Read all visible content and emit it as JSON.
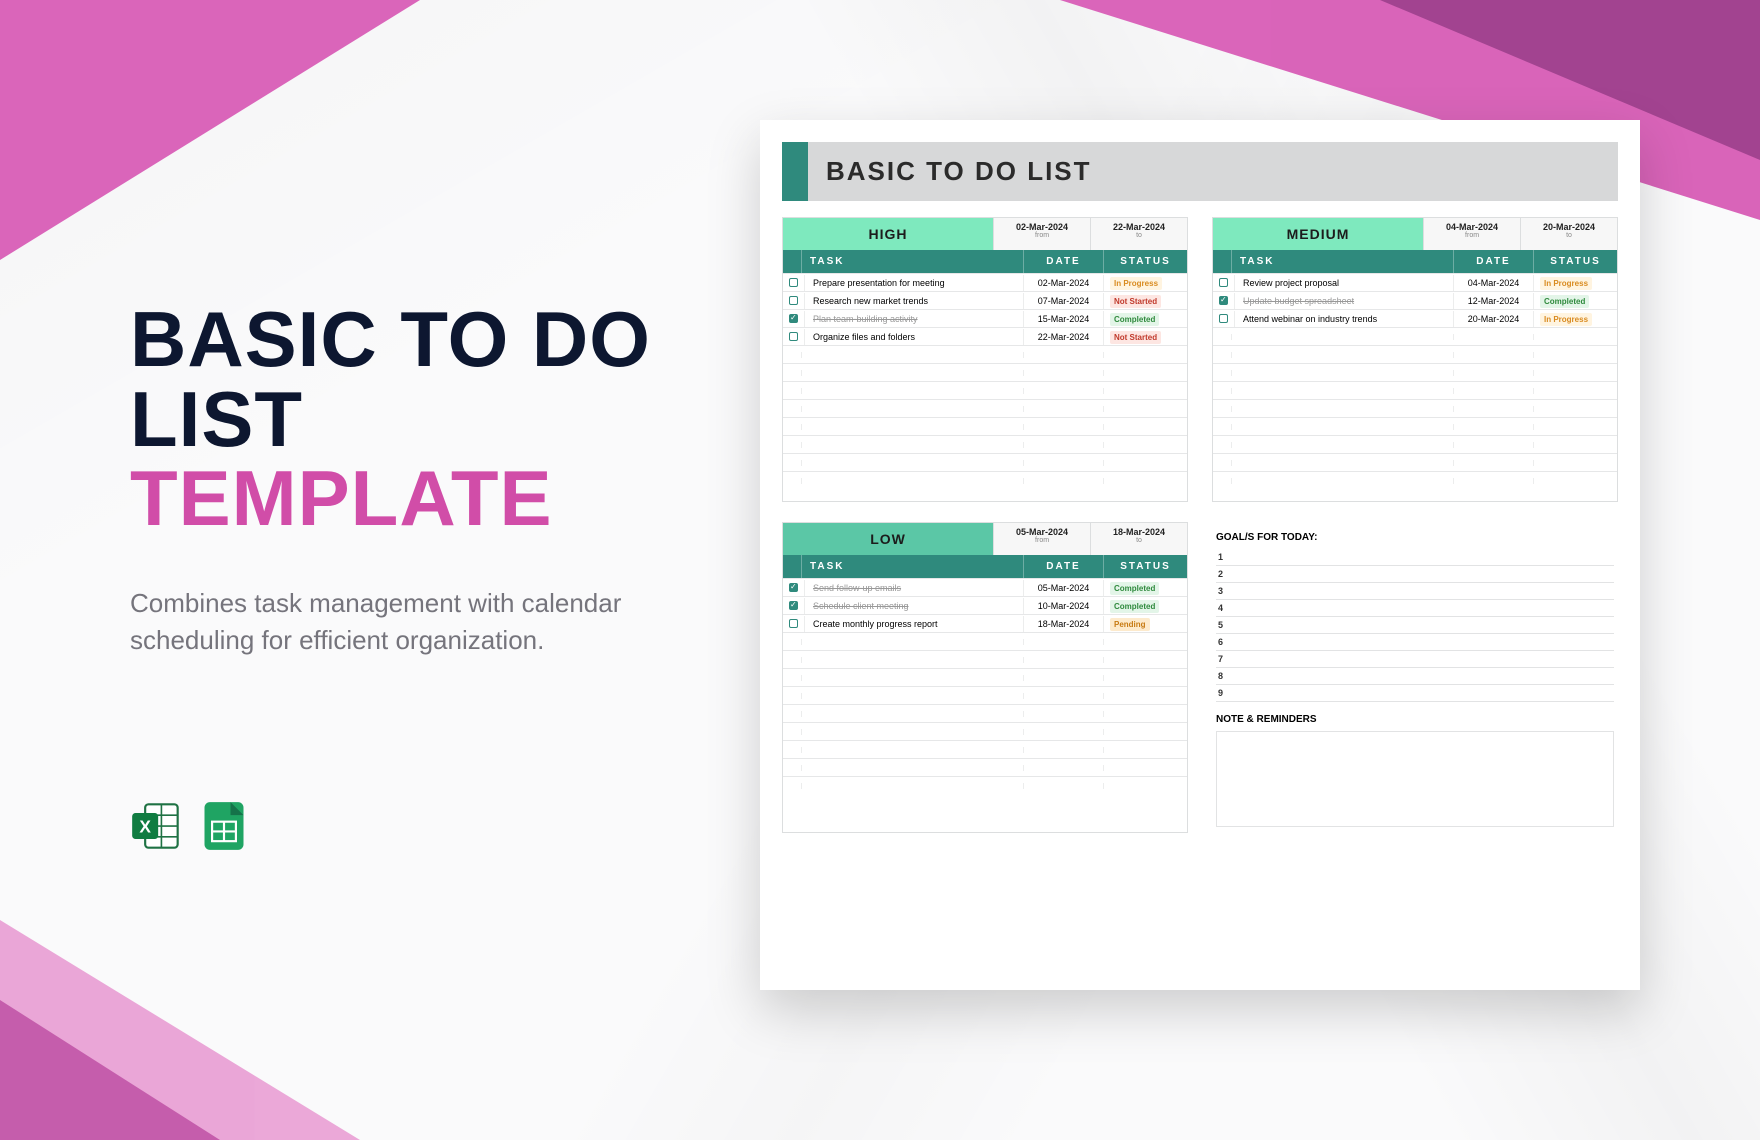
{
  "title": {
    "line1": "BASIC TO DO",
    "line2_a": "LIST ",
    "line2_b": "TEMPLATE"
  },
  "description": "Combines task management with calendar scheduling for efficient organization.",
  "document": {
    "header": "BASIC TO DO LIST",
    "columns": {
      "task": "TASK",
      "date": "DATE",
      "status": "STATUS"
    },
    "from_label": "from",
    "to_label": "to",
    "sections": {
      "high": {
        "priority": "HIGH",
        "from": "02-Mar-2024",
        "to": "22-Mar-2024",
        "tasks": [
          {
            "done": false,
            "task": "Prepare presentation for meeting",
            "date": "02-Mar-2024",
            "status": "In Progress",
            "status_class": "st-progress"
          },
          {
            "done": false,
            "task": "Research new market trends",
            "date": "07-Mar-2024",
            "status": "Not Started",
            "status_class": "st-notstarted"
          },
          {
            "done": true,
            "task": "Plan team-building activity",
            "date": "15-Mar-2024",
            "status": "Completed",
            "status_class": "st-completed"
          },
          {
            "done": false,
            "task": "Organize files and folders",
            "date": "22-Mar-2024",
            "status": "Not Started",
            "status_class": "st-notstarted"
          }
        ]
      },
      "medium": {
        "priority": "MEDIUM",
        "from": "04-Mar-2024",
        "to": "20-Mar-2024",
        "tasks": [
          {
            "done": false,
            "task": "Review project proposal",
            "date": "04-Mar-2024",
            "status": "In Progress",
            "status_class": "st-progress"
          },
          {
            "done": true,
            "task": "Update budget spreadsheet",
            "date": "12-Mar-2024",
            "status": "Completed",
            "status_class": "st-completed"
          },
          {
            "done": false,
            "task": "Attend webinar on industry trends",
            "date": "20-Mar-2024",
            "status": "In Progress",
            "status_class": "st-progress"
          }
        ]
      },
      "low": {
        "priority": "LOW",
        "from": "05-Mar-2024",
        "to": "18-Mar-2024",
        "tasks": [
          {
            "done": true,
            "task": "Send follow-up emails",
            "date": "05-Mar-2024",
            "status": "Completed",
            "status_class": "st-completed"
          },
          {
            "done": true,
            "task": "Schedule client meeting",
            "date": "10-Mar-2024",
            "status": "Completed",
            "status_class": "st-completed"
          },
          {
            "done": false,
            "task": "Create monthly progress report",
            "date": "18-Mar-2024",
            "status": "Pending",
            "status_class": "st-pending"
          }
        ]
      }
    },
    "goals_title": "GOAL/S FOR TODAY:",
    "goal_numbers": [
      "1",
      "2",
      "3",
      "4",
      "5",
      "6",
      "7",
      "8",
      "9"
    ],
    "notes_title": "NOTE & REMINDERS"
  }
}
